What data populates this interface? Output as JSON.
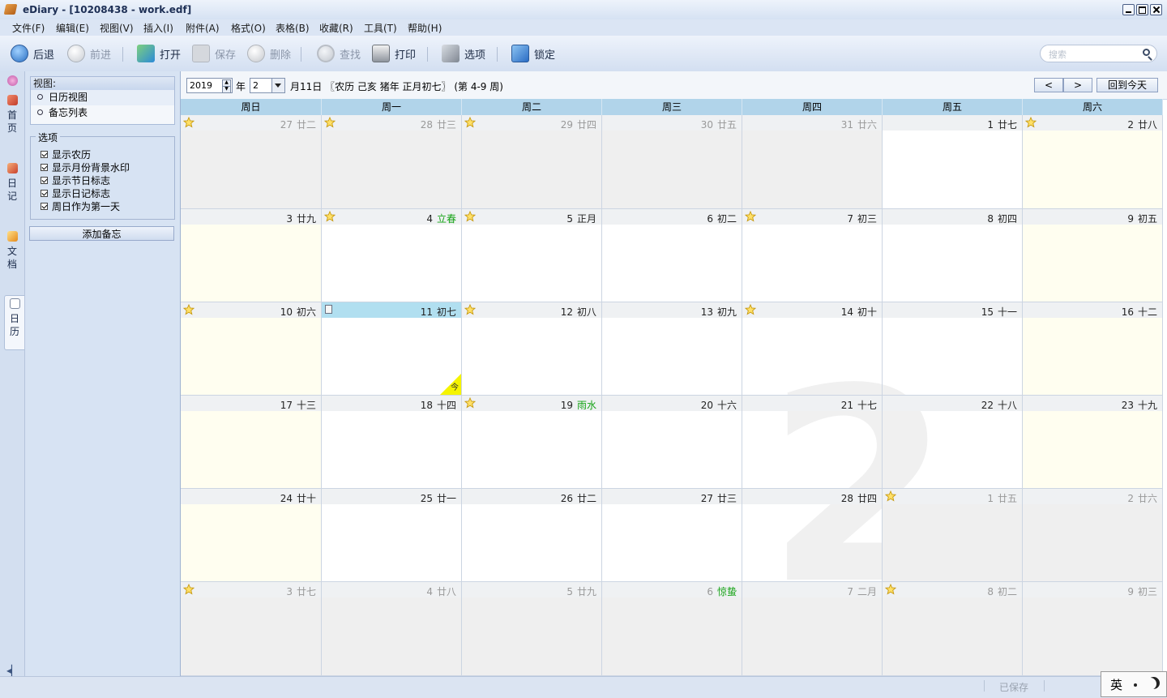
{
  "window": {
    "title": "eDiary - [10208438 - work.edf]"
  },
  "menu": [
    "文件(F)",
    "编辑(E)",
    "视图(V)",
    "插入(I)",
    "附件(A)",
    "格式(O)",
    "表格(B)",
    "收藏(R)",
    "工具(T)",
    "帮助(H)"
  ],
  "toolbar": {
    "back": "后退",
    "forward": "前进",
    "open": "打开",
    "save": "保存",
    "delete": "删除",
    "find": "查找",
    "print": "打印",
    "options": "选项",
    "lock": "锁定"
  },
  "search": {
    "placeholder": "搜索"
  },
  "sidetabs": {
    "home": "首\n页",
    "diary": "日\n记",
    "docs": "文\n档",
    "calendar": "日\n历"
  },
  "left": {
    "view_title": "视图:",
    "views": [
      "日历视图",
      "备忘列表"
    ],
    "options_title": "选项",
    "options": [
      "显示农历",
      "显示月份背景水印",
      "显示节日标志",
      "显示日记标志",
      "周日作为第一天"
    ],
    "add_memo": "添加备忘"
  },
  "nav": {
    "year": "2019",
    "year_label": "年",
    "month": "2",
    "info": "月11日 〖农历 己亥 猪年 正月初七〗 (第 4-9 周)",
    "prev": "<",
    "next": ">",
    "today_btn": "回到今天"
  },
  "weekdays": [
    "周日",
    "周一",
    "周二",
    "周三",
    "周四",
    "周五",
    "周六"
  ],
  "watermark": "2",
  "today_mark": "今",
  "weeks": [
    [
      {
        "d": "27",
        "l": "廿二",
        "other": true,
        "star": true
      },
      {
        "d": "28",
        "l": "廿三",
        "other": true,
        "star": true
      },
      {
        "d": "29",
        "l": "廿四",
        "other": true,
        "star": true
      },
      {
        "d": "30",
        "l": "廿五",
        "other": true
      },
      {
        "d": "31",
        "l": "廿六",
        "other": true
      },
      {
        "d": "1",
        "l": "廿七"
      },
      {
        "d": "2",
        "l": "廿八",
        "star": true
      }
    ],
    [
      {
        "d": "3",
        "l": "廿九"
      },
      {
        "d": "4",
        "l": "立春",
        "green": true,
        "star": true
      },
      {
        "d": "5",
        "l": "正月",
        "star": true
      },
      {
        "d": "6",
        "l": "初二"
      },
      {
        "d": "7",
        "l": "初三",
        "star": true
      },
      {
        "d": "8",
        "l": "初四"
      },
      {
        "d": "9",
        "l": "初五"
      }
    ],
    [
      {
        "d": "10",
        "l": "初六",
        "star": true
      },
      {
        "d": "11",
        "l": "初七",
        "today": true,
        "memo": true
      },
      {
        "d": "12",
        "l": "初八",
        "star": true
      },
      {
        "d": "13",
        "l": "初九"
      },
      {
        "d": "14",
        "l": "初十",
        "star": true
      },
      {
        "d": "15",
        "l": "十一"
      },
      {
        "d": "16",
        "l": "十二"
      }
    ],
    [
      {
        "d": "17",
        "l": "十三"
      },
      {
        "d": "18",
        "l": "十四"
      },
      {
        "d": "19",
        "l": "雨水",
        "green": true,
        "star": true
      },
      {
        "d": "20",
        "l": "十六"
      },
      {
        "d": "21",
        "l": "十七"
      },
      {
        "d": "22",
        "l": "十八"
      },
      {
        "d": "23",
        "l": "十九"
      }
    ],
    [
      {
        "d": "24",
        "l": "廿十"
      },
      {
        "d": "25",
        "l": "廿一"
      },
      {
        "d": "26",
        "l": "廿二"
      },
      {
        "d": "27",
        "l": "廿三"
      },
      {
        "d": "28",
        "l": "廿四"
      },
      {
        "d": "1",
        "l": "廿五",
        "other": true,
        "star": true
      },
      {
        "d": "2",
        "l": "廿六",
        "other": true
      }
    ],
    [
      {
        "d": "3",
        "l": "廿七",
        "other": true,
        "star": true
      },
      {
        "d": "4",
        "l": "廿八",
        "other": true
      },
      {
        "d": "5",
        "l": "廿九",
        "other": true
      },
      {
        "d": "6",
        "l": "惊蛰",
        "other": true,
        "green": true
      },
      {
        "d": "7",
        "l": "二月",
        "other": true
      },
      {
        "d": "8",
        "l": "初二",
        "other": true,
        "star": true
      },
      {
        "d": "9",
        "l": "初三",
        "other": true
      }
    ]
  ],
  "status": {
    "saved": "已保存"
  },
  "ime": {
    "lang": "英"
  }
}
